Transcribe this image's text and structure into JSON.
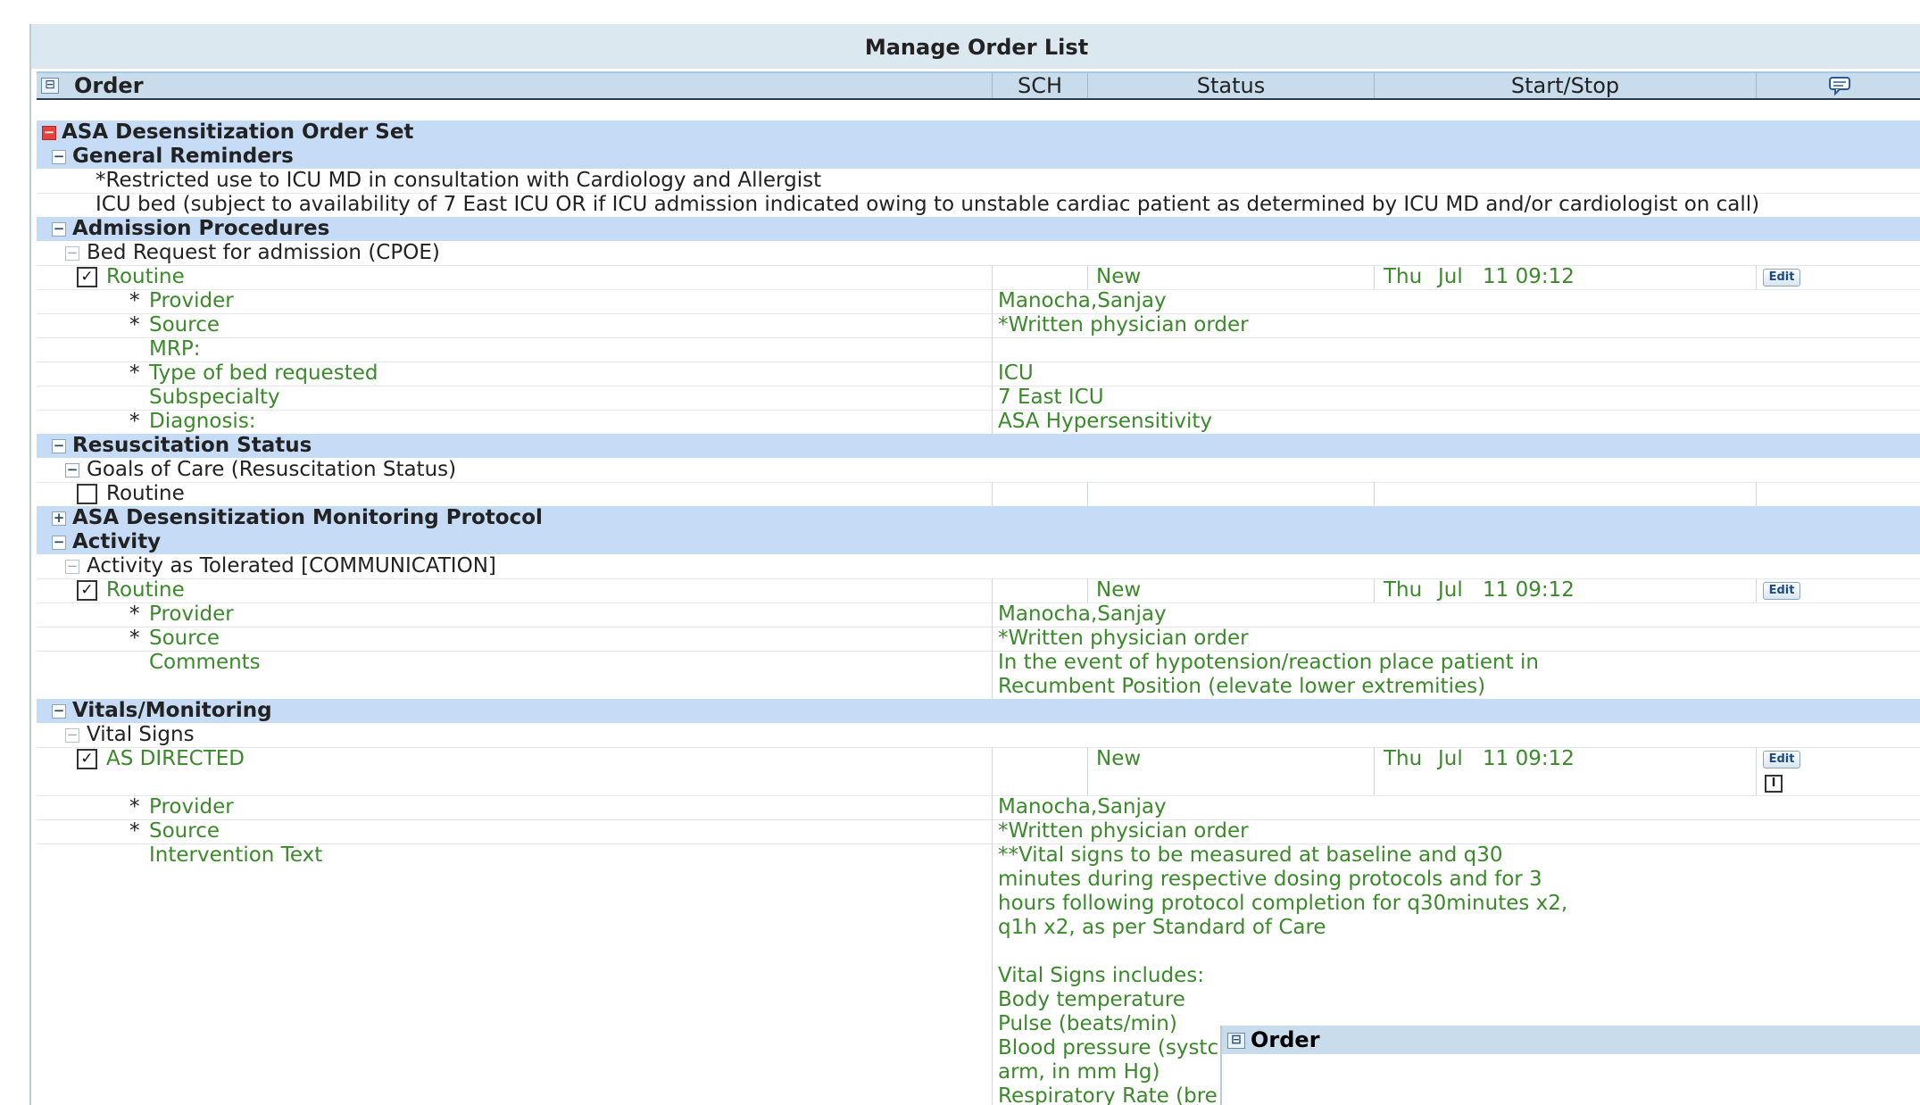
{
  "window": {
    "title": "Manage Order List"
  },
  "columns": {
    "order": "Order",
    "sch": "SCH",
    "status": "Status",
    "start_stop": "Start/Stop"
  },
  "rows": {
    "r0": "ASA Desensitization Order Set",
    "r1": "General Reminders",
    "r2": "*Restricted use to ICU MD in consultation with Cardiology and Allergist",
    "r3": "ICU bed (subject to availability of 7 East ICU OR if ICU admission indicated owing to unstable cardiac patient as determined by ICU MD and/or cardiologist on call)",
    "r4": "Admission Procedures",
    "r5": "Bed Request for admission (CPOE)",
    "r6": {
      "label": "Routine",
      "status": "New",
      "day": "Thu",
      "month": "Jul",
      "date_time": "11 09:12",
      "edit": "Edit"
    },
    "r7": {
      "star": "*",
      "label": "Provider",
      "value": "Manocha,Sanjay"
    },
    "r8": {
      "star": "*",
      "label": "Source",
      "value": "*Written physician order"
    },
    "r9": {
      "label": "MRP:",
      "value": ""
    },
    "r10": {
      "star": "*",
      "label": "Type of bed requested",
      "value": "ICU"
    },
    "r11": {
      "label": "Subspecialty",
      "value": "7 East ICU"
    },
    "r12": {
      "star": "*",
      "label": "Diagnosis:",
      "value": "ASA Hypersensitivity"
    },
    "r13": "Resuscitation Status",
    "r14": "Goals of Care (Resuscitation Status)",
    "r15": {
      "label": "Routine"
    },
    "r16": "ASA Desensitization Monitoring Protocol",
    "r17": "Activity",
    "r18": "Activity as Tolerated [COMMUNICATION]",
    "r19": {
      "label": "Routine",
      "status": "New",
      "day": "Thu",
      "month": "Jul",
      "date_time": "11 09:12",
      "edit": "Edit"
    },
    "r20": {
      "star": "*",
      "label": "Provider",
      "value": "Manocha,Sanjay"
    },
    "r21": {
      "star": "*",
      "label": "Source",
      "value": "*Written physician order"
    },
    "r22": {
      "label": "Comments",
      "lines": [
        "In the event of hypotension/reaction place patient in",
        "Recumbent Position (elevate lower extremities)"
      ]
    },
    "r23": "Vitals/Monitoring",
    "r24": "Vital Signs",
    "r25": {
      "label": "AS DIRECTED",
      "status": "New",
      "day": "Thu",
      "month": "Jul",
      "date_time": "11 09:12",
      "edit": "Edit",
      "info": "I"
    },
    "r26": {
      "star": "*",
      "label": "Provider",
      "value": "Manocha,Sanjay"
    },
    "r27": {
      "star": "*",
      "label": "Source",
      "value": "*Written physician order"
    },
    "r28": {
      "label": "Intervention Text",
      "lines": [
        "**Vital signs to be measured at baseline and q30",
        "minutes during respective dosing protocols and for 3",
        "hours following protocol completion for q30minutes x2,",
        "q1h x2, as per Standard of Care",
        "",
        "Vital Signs includes:",
        "Body temperature",
        "Pulse (beats/min)",
        "Blood pressure (systc",
        "arm, in mm Hg)",
        "Respiratory Rate (bre"
      ]
    }
  },
  "popup": {
    "title": "Order"
  },
  "icons": {
    "collapse": "minus-box-icon",
    "expand": "plus-box-icon",
    "comment": "speech-bubble-icon",
    "check": "checkmark-icon",
    "info": "info-icon"
  }
}
